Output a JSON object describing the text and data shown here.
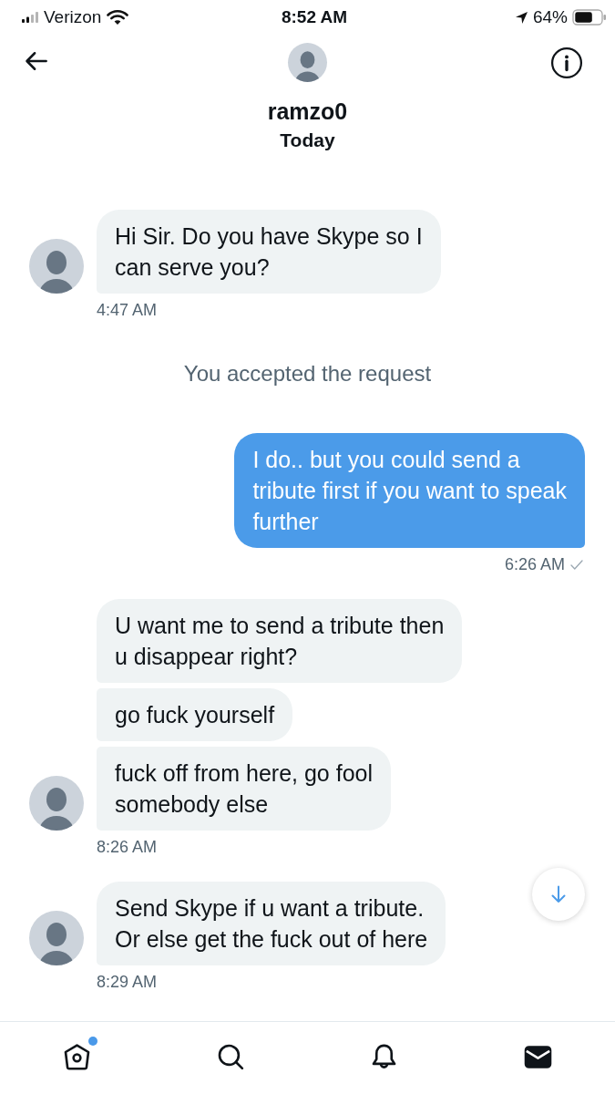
{
  "status_bar": {
    "carrier": "Verizon",
    "time": "8:52 AM",
    "battery": "64%"
  },
  "header": {
    "name": "ramzo0",
    "date": "Today"
  },
  "conversation": [
    {
      "kind": "received",
      "messages": [
        "Hi Sir. Do you have Skype so I\ncan serve you?"
      ],
      "time": "4:47 AM"
    },
    {
      "kind": "notice",
      "text": "You accepted the request"
    },
    {
      "kind": "sent",
      "messages": [
        "I do.. but you could send a\ntribute first if you want to speak\nfurther"
      ],
      "time": "6:26 AM",
      "delivered": true
    },
    {
      "kind": "received",
      "messages": [
        "U want me to send a tribute then\nu disappear right?",
        "go fuck yourself",
        "fuck off from here, go fool\nsomebody else"
      ],
      "time": "8:26 AM"
    },
    {
      "kind": "received",
      "messages": [
        "Send Skype if u want a tribute.\nOr else get the fuck out of here"
      ],
      "time": "8:29 AM"
    }
  ],
  "tab_bar": {
    "tabs": [
      {
        "kind": "home",
        "selected": false,
        "unread": true
      },
      {
        "kind": "search",
        "selected": false,
        "unread": false
      },
      {
        "kind": "notifications",
        "selected": false,
        "unread": false
      },
      {
        "kind": "messages",
        "selected": true,
        "unread": false
      }
    ]
  }
}
